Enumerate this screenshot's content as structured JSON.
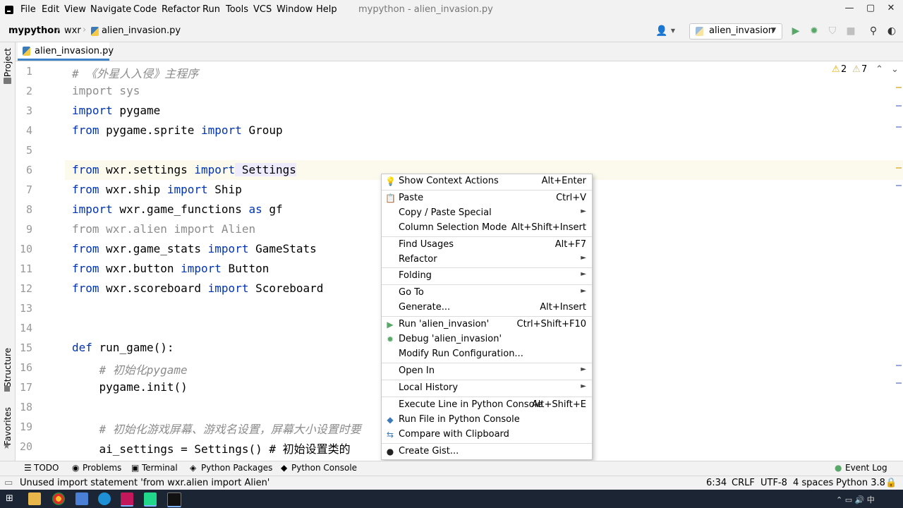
{
  "menubar": {
    "items": [
      "File",
      "Edit",
      "View",
      "Navigate",
      "Code",
      "Refactor",
      "Run",
      "Tools",
      "VCS",
      "Window",
      "Help"
    ],
    "window_title": "mypython - alien_invasion.py",
    "controls": [
      "—",
      "▢",
      "✕"
    ]
  },
  "navbar": {
    "project": "mypython",
    "folder": "wxr",
    "file": "alien_invasion.py",
    "run_config": "alien_invasion"
  },
  "left_stripe": {
    "project": "Project",
    "structure": "Structure",
    "favorites": "Favorites"
  },
  "tab": {
    "label": "alien_invasion.py"
  },
  "inspections": {
    "warnings": "2",
    "weak_warnings": "7"
  },
  "editor": {
    "lines": [
      "1",
      "2",
      "3",
      "4",
      "5",
      "6",
      "7",
      "8",
      "9",
      "10",
      "11",
      "12",
      "13",
      "14",
      "15",
      "16",
      "17",
      "18",
      "19",
      "20"
    ],
    "code": {
      "l1": "# 《外星人入侵》主程序",
      "l2a": "import",
      "l2b": " sys",
      "l3a": "import",
      "l3b": " pygame",
      "l4a": "from",
      "l4b": " pygame.sprite ",
      "l4c": "import",
      "l4d": " Group",
      "l6a": "from",
      "l6b": " wxr.settings ",
      "l6c": "import",
      "l6d": " Settings",
      "l7a": "from",
      "l7b": " wxr.ship ",
      "l7c": "import",
      "l7d": " Ship",
      "l8a": "import",
      "l8b": " wxr.game_functions ",
      "l8c": "as",
      "l8d": " gf",
      "l9": "from wxr.alien import Alien",
      "l10a": "from",
      "l10b": " wxr.game_stats ",
      "l10c": "import",
      "l10d": " GameStats",
      "l11a": "from",
      "l11b": " wxr.button ",
      "l11c": "import",
      "l11d": " Button",
      "l12a": "from",
      "l12b": " wxr.scoreboard ",
      "l12c": "import",
      "l12d": " Scoreboard",
      "l15a": "def",
      "l15b": " run_game():",
      "l16": "    # 初始化pygame",
      "l17": "    pygame.init()",
      "l19": "    # 初始化游戏屏幕、游戏名设置，屏幕大小设置时要",
      "l20": "    ai_settings = Settings() # 初始设置类的"
    }
  },
  "context_menu": {
    "items": [
      {
        "label": "Show Context Actions",
        "shortcut": "Alt+Enter"
      },
      {
        "label": "Paste",
        "shortcut": "Ctrl+V"
      },
      {
        "label": "Copy / Paste Special",
        "shortcut": "►"
      },
      {
        "label": "Column Selection Mode",
        "shortcut": "Alt+Shift+Insert"
      },
      {
        "label": "Find Usages",
        "shortcut": "Alt+F7"
      },
      {
        "label": "Refactor",
        "shortcut": "►"
      },
      {
        "label": "Folding",
        "shortcut": "►"
      },
      {
        "label": "Go To",
        "shortcut": "►"
      },
      {
        "label": "Generate...",
        "shortcut": "Alt+Insert"
      },
      {
        "label": "Run 'alien_invasion'",
        "shortcut": "Ctrl+Shift+F10"
      },
      {
        "label": "Debug 'alien_invasion'",
        "shortcut": ""
      },
      {
        "label": "Modify Run Configuration...",
        "shortcut": ""
      },
      {
        "label": "Open In",
        "shortcut": "►"
      },
      {
        "label": "Local History",
        "shortcut": "►"
      },
      {
        "label": "Execute Line in Python Console",
        "shortcut": "Alt+Shift+E"
      },
      {
        "label": "Run File in Python Console",
        "shortcut": ""
      },
      {
        "label": "Compare with Clipboard",
        "shortcut": ""
      },
      {
        "label": "Create Gist...",
        "shortcut": ""
      }
    ]
  },
  "bottombar": {
    "todo": "TODO",
    "problems": "Problems",
    "terminal": "Terminal",
    "packages": "Python Packages",
    "console": "Python Console",
    "eventlog": "Event Log"
  },
  "statusbar": {
    "message": "Unused import statement 'from wxr.alien import Alien'",
    "position": "6:34",
    "line_sep": "CRLF",
    "encoding": "UTF-8",
    "indent": "4 spaces",
    "interpreter": "Python 3.8"
  },
  "colors": {
    "keyword": "#0033b3",
    "comment": "#8c8c8c",
    "accent": "#4083c9",
    "run_green": "#59a869"
  }
}
